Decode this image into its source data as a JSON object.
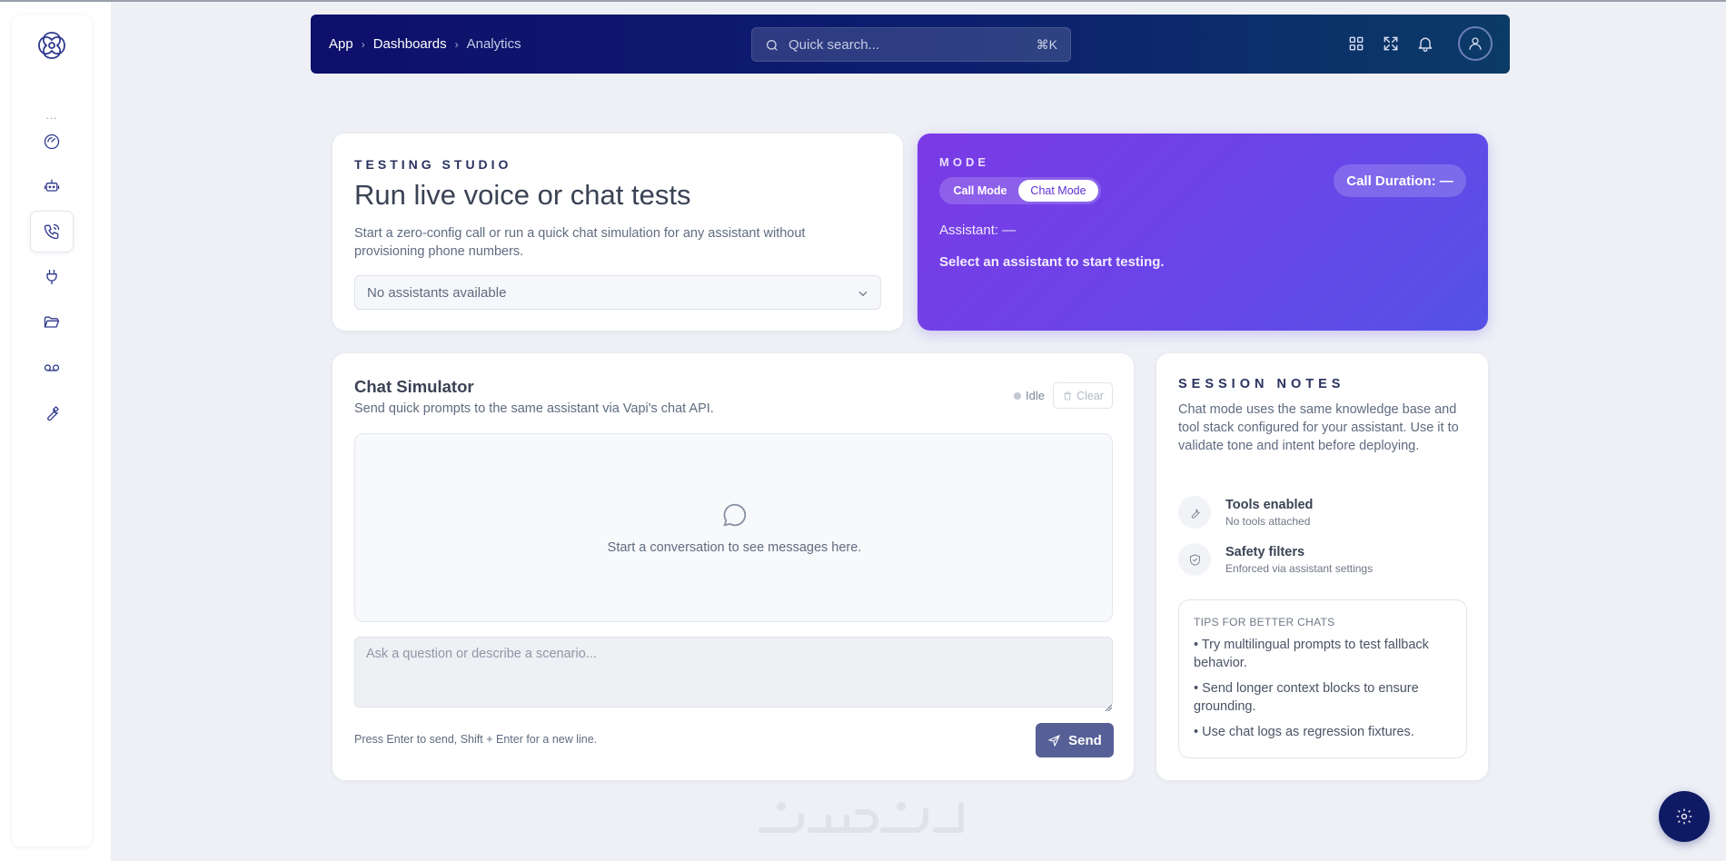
{
  "header": {
    "breadcrumbs": [
      "App",
      "Dashboards",
      "Analytics"
    ],
    "search_placeholder": "Quick search...",
    "search_shortcut": "⌘K",
    "icons": [
      "grid-icon",
      "fullscreen-icon",
      "bell-icon",
      "user-avatar-icon"
    ]
  },
  "sidebar": {
    "more": "...",
    "items": [
      {
        "icon": "gauge-icon",
        "active": false
      },
      {
        "icon": "robot-icon",
        "active": false
      },
      {
        "icon": "phone-call-icon",
        "active": true
      },
      {
        "icon": "plug-icon",
        "active": false
      },
      {
        "icon": "folder-open-icon",
        "active": false
      },
      {
        "icon": "voicemail-icon",
        "active": false
      },
      {
        "icon": "wrench-icon",
        "active": false
      }
    ]
  },
  "studio": {
    "eyebrow": "TESTING STUDIO",
    "title": "Run live voice or chat tests",
    "description": "Start a zero-config call or run a quick chat simulation for any assistant without provisioning phone numbers.",
    "select_value": "No assistants available"
  },
  "mode": {
    "eyebrow": "MODE",
    "call_label": "Call Mode",
    "chat_label": "Chat Mode",
    "selected": "Chat Mode",
    "duration_label": "Call Duration: —",
    "assistant_label": "Assistant: —",
    "hint": "Select an assistant to start testing."
  },
  "chat": {
    "title": "Chat Simulator",
    "subtitle": "Send quick prompts to the same assistant via Vapi's chat API.",
    "status": "Idle",
    "clear_label": "Clear",
    "empty_text": "Start a conversation to see messages here.",
    "input_placeholder": "Ask a question or describe a scenario...",
    "help_text": "Press Enter to send, Shift + Enter for a new line.",
    "send_label": "Send"
  },
  "notes": {
    "eyebrow": "SESSION NOTES",
    "description": "Chat mode uses the same knowledge base and tool stack configured for your assistant. Use it to validate tone and intent before deploying.",
    "items": [
      {
        "title": "Tools enabled",
        "subtitle": "No tools attached",
        "icon": "wrench-icon"
      },
      {
        "title": "Safety filters",
        "subtitle": "Enforced via assistant settings",
        "icon": "shield-check-icon"
      }
    ],
    "tips_title": "TIPS FOR BETTER CHATS",
    "tips": [
      "• Try multilingual prompts to test fallback behavior.",
      "• Send longer context blocks to ensure grounding.",
      "• Use chat logs as regression fixtures."
    ]
  },
  "colors": {
    "header_start": "#0e0f6b",
    "header_end": "#0b3b67",
    "mode_start": "#7b3ae6",
    "mode_end": "#5552e6",
    "send_button": "#565f96",
    "fab": "#0f1a64"
  }
}
